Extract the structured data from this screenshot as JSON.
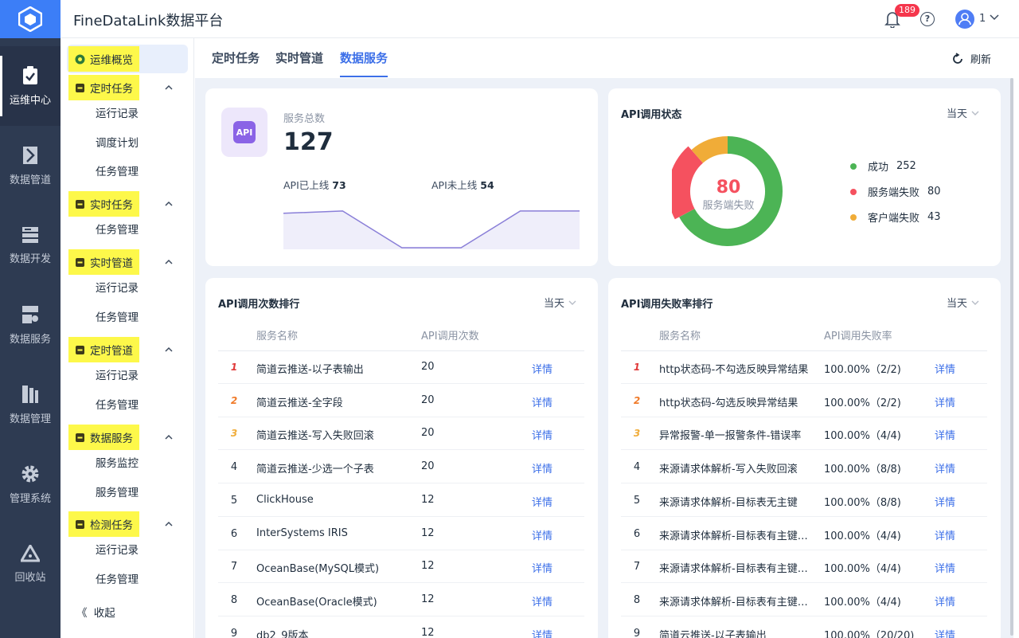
{
  "app": {
    "title": "FineDataLink数据平台"
  },
  "header": {
    "notification_count": "189",
    "help_glyph": "?",
    "user_name": "1"
  },
  "rail": {
    "items": [
      {
        "label": "运维中心",
        "icon": "clipboard-check-icon"
      },
      {
        "label": "数据管道",
        "icon": "pipeline-icon"
      },
      {
        "label": "数据开发",
        "icon": "stack-icon"
      },
      {
        "label": "数据服务",
        "icon": "service-icon"
      },
      {
        "label": "数据管理",
        "icon": "database-icon"
      },
      {
        "label": "管理系统",
        "icon": "gear-icon"
      },
      {
        "label": "回收站",
        "icon": "recycle-icon"
      }
    ]
  },
  "sidebar": {
    "overview": "运维概览",
    "groups": [
      {
        "label": "定时任务",
        "icon": "schedule-task-icon",
        "children": [
          "运行记录",
          "调度计划",
          "任务管理"
        ]
      },
      {
        "label": "实时任务",
        "icon": "realtime-task-icon",
        "children": [
          "任务管理"
        ]
      },
      {
        "label": "实时管道",
        "icon": "realtime-pipeline-icon",
        "children": [
          "运行记录",
          "任务管理"
        ]
      },
      {
        "label": "定时管道",
        "icon": "schedule-pipeline-icon",
        "children": [
          "运行记录",
          "任务管理"
        ]
      },
      {
        "label": "数据服务",
        "icon": "data-service-icon",
        "children": [
          "服务监控",
          "服务管理"
        ]
      },
      {
        "label": "检测任务",
        "icon": "monitor-task-icon",
        "children": [
          "运行记录",
          "任务管理"
        ]
      }
    ],
    "collapse_label": "收起",
    "collapse_glyph": "《"
  },
  "tabs": {
    "items": [
      "定时任务",
      "实时管道",
      "数据服务"
    ],
    "active": 2,
    "refresh_label": "刷新"
  },
  "summary": {
    "api_badge": "API",
    "total_label": "服务总数",
    "total_value": "127",
    "online_label": "API已上线",
    "online_value": "73",
    "offline_label": "API未上线",
    "offline_value": "54",
    "trend": [
      45,
      48,
      0,
      0,
      48,
      48
    ]
  },
  "call_status": {
    "title": "API调用状态",
    "range": "当天",
    "center_value": "80",
    "center_label": "服务端失败",
    "legend": [
      {
        "label": "成功",
        "value": "252",
        "color": "#4cb455"
      },
      {
        "label": "服务端失败",
        "value": "80",
        "color": "#f5515f"
      },
      {
        "label": "客户端失败",
        "value": "43",
        "color": "#f0ac38"
      }
    ]
  },
  "call_rank": {
    "title": "API调用次数排行",
    "range": "当天",
    "columns": [
      "服务名称",
      "API调用次数"
    ],
    "detail_label": "详情",
    "rows": [
      {
        "rank": "1",
        "name": "简道云推送-以子表输出",
        "value": "20"
      },
      {
        "rank": "2",
        "name": "简道云推送-全字段",
        "value": "20"
      },
      {
        "rank": "3",
        "name": "简道云推送-写入失败回滚",
        "value": "20"
      },
      {
        "rank": "4",
        "name": "简道云推送-少选一个子表",
        "value": "20"
      },
      {
        "rank": "5",
        "name": "ClickHouse",
        "value": "12"
      },
      {
        "rank": "6",
        "name": "InterSystems IRIS",
        "value": "12"
      },
      {
        "rank": "7",
        "name": "OceanBase(MySQL模式)",
        "value": "12"
      },
      {
        "rank": "8",
        "name": "OceanBase(Oracle模式)",
        "value": "12"
      },
      {
        "rank": "9",
        "name": "db2_9版本",
        "value": "12"
      }
    ]
  },
  "fail_rank": {
    "title": "API调用失败率排行",
    "range": "当天",
    "columns": [
      "服务名称",
      "API调用失败率"
    ],
    "detail_label": "详情",
    "rows": [
      {
        "rank": "1",
        "name": "http状态码-不勾选反映异常结果",
        "value": "100.00%（2/2)"
      },
      {
        "rank": "2",
        "name": "http状态码-勾选反映异常结果",
        "value": "100.00%（2/2)"
      },
      {
        "rank": "3",
        "name": "异常报警-单一报警条件-错误率",
        "value": "100.00%（4/4)"
      },
      {
        "rank": "4",
        "name": "来源请求体解析-写入失败回滚",
        "value": "100.00%（8/8)"
      },
      {
        "rank": "5",
        "name": "来源请求体解析-目标表无主键",
        "value": "100.00%（8/8)"
      },
      {
        "rank": "6",
        "name": "来源请求体解析-目标表有主键-...",
        "value": "100.00%（4/4)"
      },
      {
        "rank": "7",
        "name": "来源请求体解析-目标表有主键-...",
        "value": "100.00%（4/4)"
      },
      {
        "rank": "8",
        "name": "来源请求体解析-目标表有主键-...",
        "value": "100.00%（4/4)"
      },
      {
        "rank": "9",
        "name": "简道云推送-以子表输出",
        "value": "100.00%（20/20)"
      }
    ]
  }
}
